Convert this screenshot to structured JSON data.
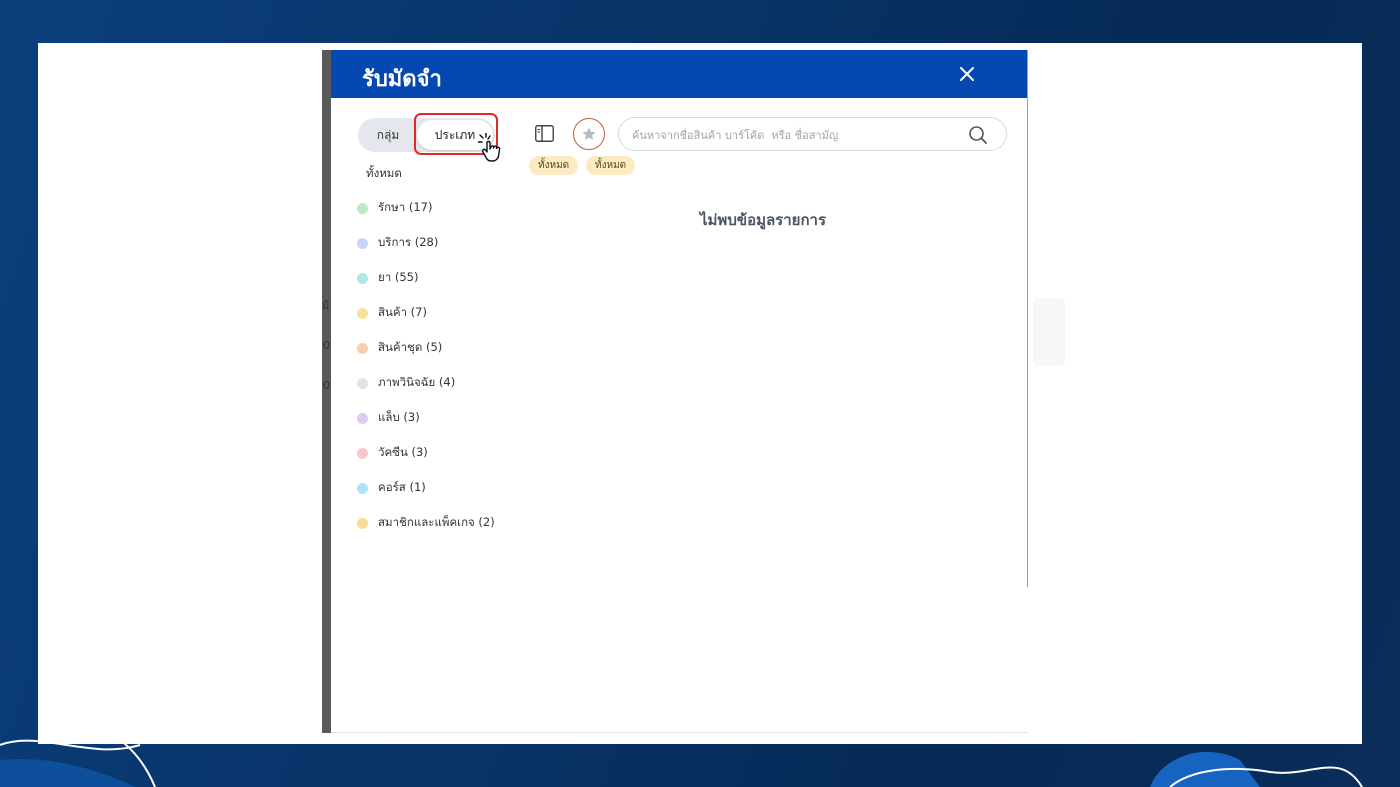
{
  "modal": {
    "title": "รับมัดจำ",
    "close_label": "✕"
  },
  "tabs": {
    "group_label": "กลุ่ม",
    "type_label": "ประเภท",
    "active": "type"
  },
  "filter": {
    "all_label": "ทั้งหมด"
  },
  "categories": [
    {
      "label": "รักษา (17)",
      "color": "#bfe8c9"
    },
    {
      "label": "บริการ (28)",
      "color": "#c7d6f5"
    },
    {
      "label": "ยา (55)",
      "color": "#aee8e2"
    },
    {
      "label": "สินค้า (7)",
      "color": "#f6e39b"
    },
    {
      "label": "สินค้าชุด (5)",
      "color": "#f8d0b0"
    },
    {
      "label": "ภาพวินิจฉัย (4)",
      "color": "#dfe3ea"
    },
    {
      "label": "แล็บ (3)",
      "color": "#dccbf5"
    },
    {
      "label": "วัคซีน (3)",
      "color": "#f6c8cb"
    },
    {
      "label": "คอร์ส (1)",
      "color": "#aee4f5"
    },
    {
      "label": "สมาชิกและแพ็คเกจ (2)",
      "color": "#f6dc95"
    }
  ],
  "search": {
    "placeholder": "ค้นหาจากชื่อสินค้า บาร์โค้ด  หรือ ชื่อสามัญ",
    "value": ""
  },
  "chips": [
    "ทั้งหมด",
    "ทั้งหมด"
  ],
  "empty_message": "ไม่พบข้อมูลรายการ",
  "underlay": {
    "fragments": [
      "ม้",
      "0",
      "0"
    ]
  },
  "colors": {
    "header_bg": "#0548b1",
    "highlight": "#e02a2a",
    "star_border": "#c95a3d",
    "chip_bg": "#fbeac2"
  },
  "icons": {
    "close": "close-icon",
    "panel": "sidebar-panel-icon",
    "favorite": "star-icon",
    "search": "search-icon",
    "cursor": "hand-pointer-icon"
  }
}
